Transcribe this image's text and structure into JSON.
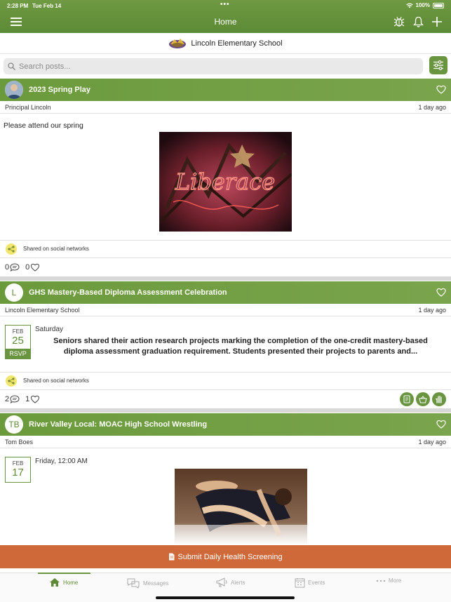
{
  "status_bar": {
    "time": "2:28 PM",
    "date": "Tue Feb 14",
    "dots": "•••",
    "battery": "100%"
  },
  "nav": {
    "title": "Home"
  },
  "school": {
    "name": "Lincoln Elementary School"
  },
  "search": {
    "placeholder": "Search posts..."
  },
  "posts": [
    {
      "title": "2023 Spring Play",
      "author": "Principal Lincoln",
      "time": "1 day ago",
      "body": "Please attend our spring",
      "image_caption": "Liberace",
      "shared_label": "Shared on social networks",
      "comments": "0",
      "likes": "0"
    },
    {
      "avatar": "L",
      "title": "GHS Mastery-Based Diploma Assessment Celebration",
      "author": "Lincoln Elementary School",
      "time": "1 day ago",
      "event": {
        "month": "FEB",
        "day": "25",
        "rsvp": "RSVP",
        "when": "Saturday"
      },
      "body": "Seniors shared their action research projects marking the completion of the one-credit mastery-based diploma assessment graduation requirement. Students presented their projects to parents and...",
      "shared_label": "Shared on social networks",
      "comments": "2",
      "likes": "1"
    },
    {
      "avatar": "TB",
      "title": "River Valley Local:  MOAC High School Wrestling",
      "author": "Tom Boes",
      "time": "1 day ago",
      "event": {
        "month": "FEB",
        "day": "17",
        "when": "Friday, 12:00 AM"
      }
    }
  ],
  "health_button": {
    "label": "Submit Daily Health Screening"
  },
  "tabs": [
    {
      "label": "Home",
      "icon": "home-icon",
      "active": true
    },
    {
      "label": "Messages",
      "icon": "chat-icon"
    },
    {
      "label": "Alerts",
      "icon": "megaphone-icon"
    },
    {
      "label": "Events",
      "icon": "calendar-icon"
    },
    {
      "label": "More",
      "icon": "ellipsis-icon"
    }
  ],
  "colors": {
    "brand_green": "#6a9540",
    "health_orange": "#d0693a"
  }
}
